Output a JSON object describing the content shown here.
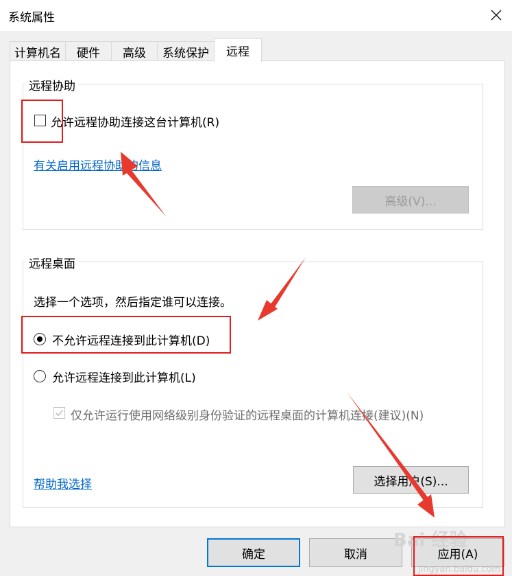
{
  "window": {
    "title": "系统属性",
    "close_icon": "close-icon"
  },
  "tabs": [
    {
      "label": "计算机名",
      "active": false
    },
    {
      "label": "硬件",
      "active": false
    },
    {
      "label": "高级",
      "active": false
    },
    {
      "label": "系统保护",
      "active": false
    },
    {
      "label": "远程",
      "active": true
    }
  ],
  "remote_assistance": {
    "group_title": "远程协助",
    "allow_checkbox_label": "允许远程协助连接这台计算机(R)",
    "allow_checked": false,
    "info_link": "有关启用远程协助的信息",
    "advanced_button": "高级(V)..."
  },
  "remote_desktop": {
    "group_title": "远程桌面",
    "instruction": "选择一个选项，然后指定谁可以连接。",
    "option_deny": "不允许远程连接到此计算机(D)",
    "option_allow": "允许远程连接到此计算机(L)",
    "selected_option": "deny",
    "nla_checkbox_label": "仅允许运行使用网络级别身份验证的远程桌面的计算机连接(建议)(N)",
    "nla_checked": true,
    "help_link": "帮助我选择",
    "select_users_button": "选择用户(S)..."
  },
  "footer": {
    "ok_button": "确定",
    "cancel_button": "取消",
    "apply_button": "应用(A)"
  },
  "annotations": {
    "highlight_color": "#e21b1b",
    "arrow_color": "#e8392f"
  },
  "watermark": {
    "text": "Bai 经验",
    "sub": "jingyan.baidu.com"
  }
}
